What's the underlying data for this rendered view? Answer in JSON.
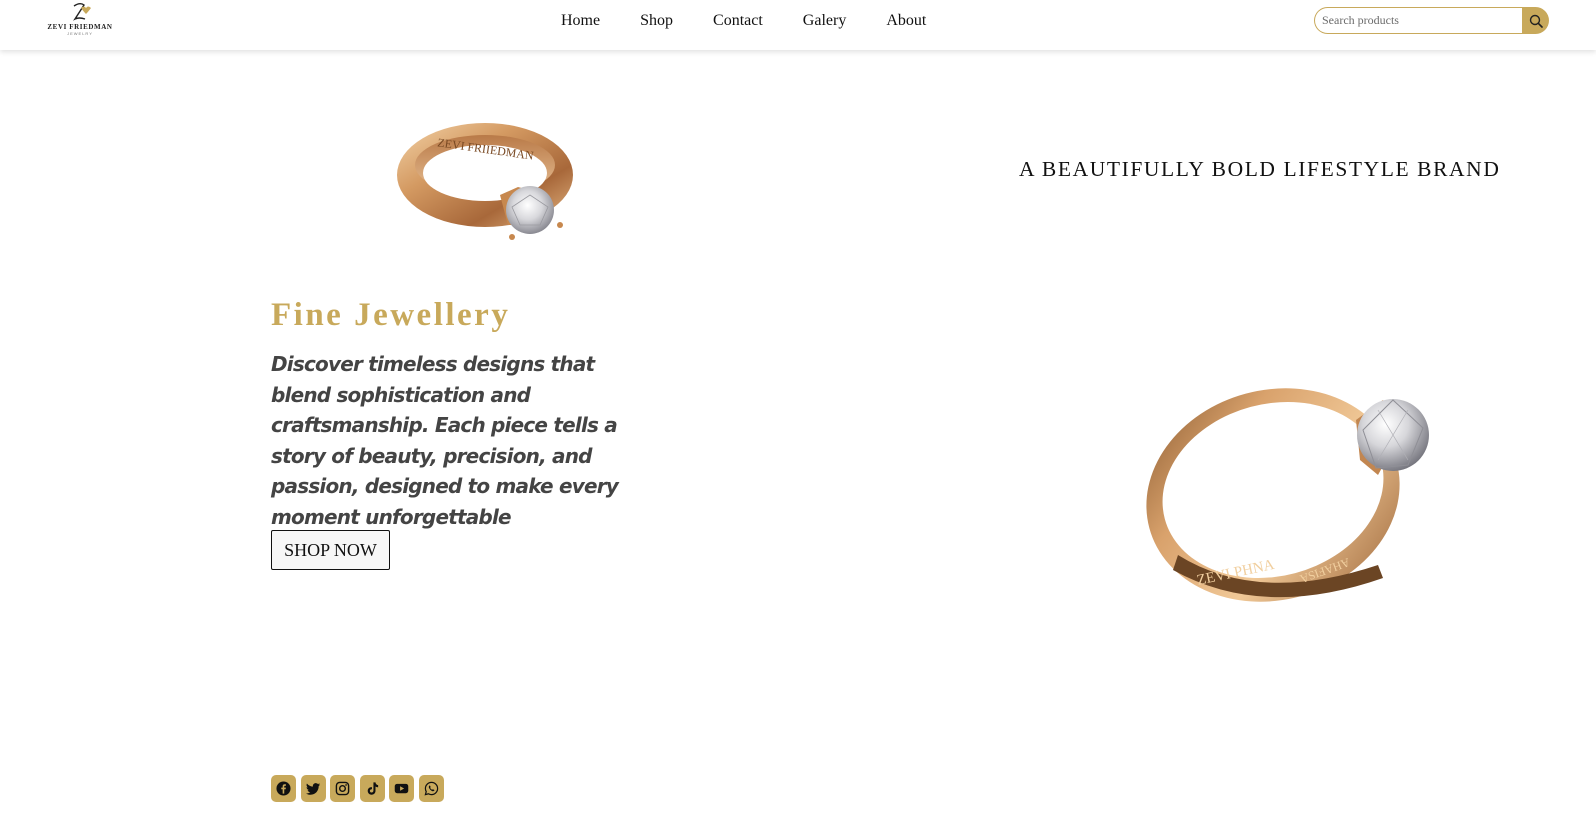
{
  "brand": {
    "logo_text": "ZEVI FRIEDMAN",
    "logo_sub": "JEWELRY"
  },
  "nav": {
    "items": [
      {
        "label": "Home"
      },
      {
        "label": "Shop"
      },
      {
        "label": "Contact"
      },
      {
        "label": "Galery"
      },
      {
        "label": "About"
      }
    ]
  },
  "search": {
    "placeholder": "Search products",
    "value": "",
    "icon": "search-icon"
  },
  "hero": {
    "title": "Fine Jewellery",
    "description": "Discover timeless designs that blend sophistication and craftsmanship. Each piece tells a story of beauty, precision, and passion, designed to make every moment unforgettable",
    "button_label": "SHOP NOW",
    "tagline": "A BEAUTIFULLY BOLD LIFESTYLE BRAND",
    "ring_left_engraving": "ZEVI FRIIEDMAN",
    "ring_right_engraving": "ZEVI PHNA",
    "ring_right_engraving_2": "AHAFISA"
  },
  "social": {
    "icons": [
      "facebook-icon",
      "twitter-icon",
      "instagram-icon",
      "tiktok-icon",
      "youtube-icon",
      "whatsapp-icon"
    ]
  },
  "colors": {
    "accent": "#c8a95b",
    "text": "#111111",
    "description": "#444444",
    "ring_gold": "#c98a52"
  }
}
